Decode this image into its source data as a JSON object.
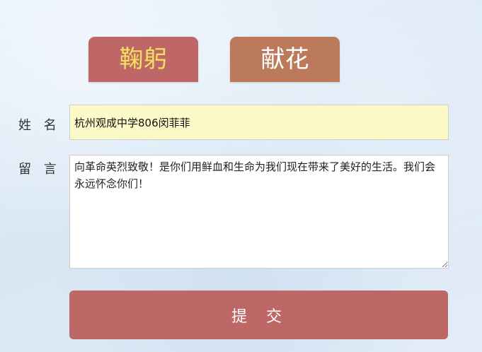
{
  "tabs": {
    "bow_label": "鞠躬",
    "flower_label": "献花"
  },
  "form": {
    "name_label": "姓 名",
    "name_value": "杭州观成中学806闵菲菲",
    "message_label": "留 言",
    "message_value": "向革命英烈致敬！是你们用鲜血和生命为我们现在带来了美好的生活。我们会永远怀念你们！",
    "submit_label": "提 交"
  },
  "colors": {
    "bow_tab_bg": "#bf6766",
    "bow_tab_text": "#f2e15e",
    "flower_tab_bg": "#ba7a5b",
    "name_field_bg": "#fcfac6",
    "submit_bg": "#bd6766"
  }
}
